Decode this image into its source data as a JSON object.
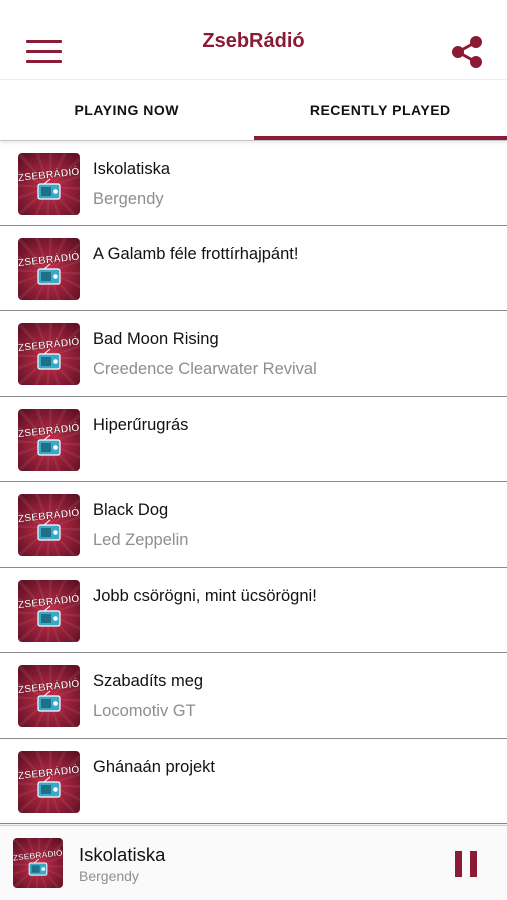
{
  "header": {
    "title": "ZsebRádió",
    "menu_icon": "hamburger-menu-icon",
    "share_icon": "share-icon"
  },
  "tabs": [
    {
      "label": "PLAYING NOW",
      "active": false
    },
    {
      "label": "RECENTLY PLAYED",
      "active": true
    }
  ],
  "thumbnail_logo_text": "ZSEBRÁDIÓ",
  "recently_played": [
    {
      "song": "Iskolatiska",
      "artist": "Bergendy"
    },
    {
      "song": "A Galamb féle frottírhajpánt!",
      "artist": ""
    },
    {
      "song": "Bad Moon Rising",
      "artist": "Creedence Clearwater Revival"
    },
    {
      "song": "Hiperűrugrás",
      "artist": ""
    },
    {
      "song": "Black Dog",
      "artist": "Led Zeppelin"
    },
    {
      "song": "Jobb csörögni, mint ücsörögni!",
      "artist": ""
    },
    {
      "song": "Szabadíts meg",
      "artist": "Locomotiv GT"
    },
    {
      "song": "Ghánaán projekt",
      "artist": ""
    }
  ],
  "player": {
    "song": "Iskolatiska",
    "artist": "Bergendy",
    "control_icon": "pause-icon"
  },
  "colors": {
    "accent": "#8b1a35",
    "secondary_text": "#8e8e8e"
  }
}
